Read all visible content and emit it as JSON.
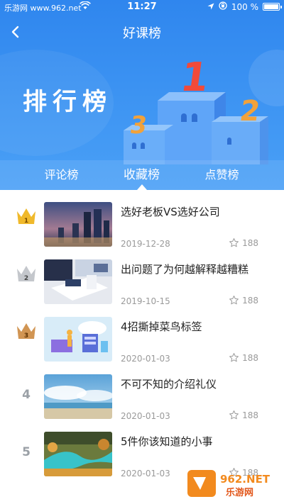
{
  "status_bar": {
    "carrier": "乐游网 www.962.net",
    "time": "11:27",
    "battery": "100 %"
  },
  "nav": {
    "title": "好课榜"
  },
  "banner": {
    "title": "排行榜"
  },
  "tabs": [
    {
      "label": "评论榜",
      "active": false
    },
    {
      "label": "收藏榜",
      "active": true
    },
    {
      "label": "点赞榜",
      "active": false
    }
  ],
  "items": [
    {
      "rank": "1",
      "medal": "gold",
      "title": "选好老板VS选好公司",
      "date": "2019-12-28",
      "favorites": "188",
      "thumb": "city-skyline"
    },
    {
      "rank": "2",
      "medal": "silver",
      "title": "出问题了为何越解释越糟糕",
      "date": "2019-10-15",
      "favorites": "188",
      "thumb": "business-meeting"
    },
    {
      "rank": "3",
      "medal": "bronze",
      "title": "4招撕掉菜鸟标签",
      "date": "2020-01-03",
      "favorites": "188",
      "thumb": "tech-illustration"
    },
    {
      "rank": "4",
      "medal": "",
      "title": "不可不知的介绍礼仪",
      "date": "2020-01-03",
      "favorites": "188",
      "thumb": "sea-sky"
    },
    {
      "rank": "5",
      "medal": "",
      "title": "5件你该知道的小事",
      "date": "2020-01-03",
      "favorites": "188",
      "thumb": "river-landscape"
    }
  ],
  "colors": {
    "primary": "#2f86ee",
    "gold": "#f0b92b",
    "silver": "#c4c7cc",
    "bronze": "#d19553"
  },
  "watermark": {
    "text_top": "962.NET",
    "text_bottom": "乐游网"
  }
}
